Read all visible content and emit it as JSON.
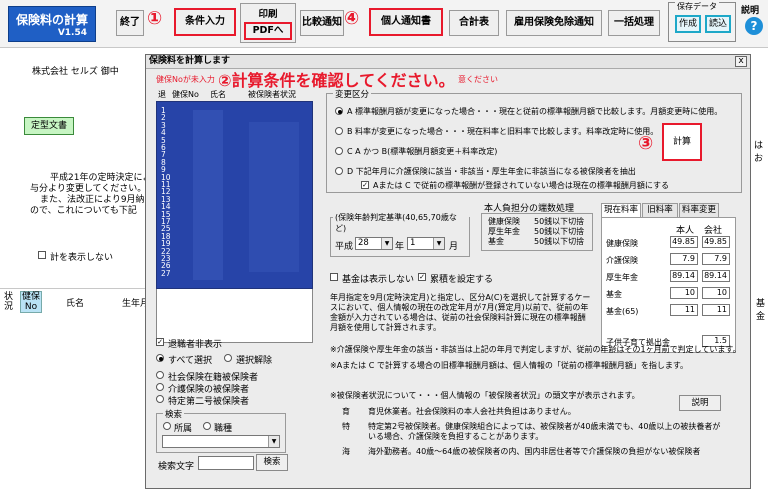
{
  "toolbar": {
    "app_title": "保険料の計算",
    "version": "V1.54",
    "end_label": "終了",
    "badge1": "①",
    "conditions_label": "条件入力",
    "print_label": "印刷",
    "pdf_label": "PDFへ",
    "compare_label": "比較通知",
    "badge4": "④",
    "personal_notice_label": "個人通知書",
    "summary_label": "合計表",
    "exemption_label": "雇用保険免除通知",
    "batch_label": "一括処理",
    "save_data_label": "保存データ",
    "create_label": "作成",
    "load_label": "読込",
    "help_label": "説明"
  },
  "sheet": {
    "company": "株式会社 セルズ 御中",
    "fixed_doc_label": "定型文書",
    "line1": "平成21年の定時決定によ",
    "line2": "与分より変更してください。",
    "line3": "また、法改正により9月納入",
    "line4": "ので、これについても下記",
    "calc_hide_label": "計を表示しない",
    "col_status": "状況",
    "col_health": "健保No",
    "col_name": "氏名",
    "col_birth": "生年月",
    "col_right": "基金",
    "right_text": "はお"
  },
  "dialog": {
    "title": "保険料を計算します",
    "close": "x",
    "notice_prefix": "健保Noが未入力",
    "headline": "②計算条件を確認してください。",
    "notice_suffix": "意ください",
    "list_headers": [
      "退",
      "健保No",
      "氏名",
      "被保険者状況"
    ],
    "employee_numbers": [
      "1",
      "2",
      "3",
      "4",
      "5",
      "6",
      "7",
      "8",
      "9",
      "10",
      "11",
      "12",
      "13",
      "14",
      "15",
      "17",
      "25",
      "18",
      "19",
      "22",
      "23",
      "26",
      "27"
    ],
    "change_group_label": "変更区分",
    "options": [
      "A 標準報酬月額が変更になった場合・・・現在と従前の標準報酬月額で比較します。月額変更時に使用。",
      "B 料率が変更になった場合・・・現在料率と旧料率で比較します。料率改定時に使用。",
      "C A かつ B(標準報酬月額変更＋料率改定)",
      "D 下記年月に介護保険に該当・非該当・厚生年金に非該当になる被保険者を抽出"
    ],
    "option_checkbox": "Aまたは C で従前の標準報酬が登録されていない場合は現在の標準報酬月額にする",
    "badge3": "③",
    "calc_button": "計算",
    "ref_month_label": "(保険年齢判定基準(40,65,70歳など)",
    "era": "平成",
    "year": "28",
    "year_suffix": "年",
    "month": "1",
    "month_suffix": "月",
    "burden_label": "本人負担分の端数処理",
    "burden_rows": [
      {
        "name": "健康保険",
        "rule": "50銭以下切捨"
      },
      {
        "name": "厚生年金",
        "rule": "50銭以下切捨"
      },
      {
        "name": "基金",
        "rule": "50銭以下切捨"
      }
    ],
    "rate_tabs": [
      "現在料率",
      "旧料率",
      "料率変更"
    ],
    "rate_head_self": "本人",
    "rate_head_company": "会社",
    "rates": [
      {
        "name": "健康保険",
        "self": "49.85",
        "company": "49.85"
      },
      {
        "name": "介護保険",
        "self": "7.9",
        "company": "7.9"
      },
      {
        "name": "厚生年金",
        "self": "89.14",
        "company": "89.14"
      },
      {
        "name": "基金",
        "self": "10",
        "company": "10"
      },
      {
        "name": "基金(65)",
        "self": "11",
        "company": "11"
      }
    ],
    "child_label": "子供子育て拠出金",
    "child_value": "1.5",
    "fund_hide": "基金は表示しない",
    "accumulate": "累積を設定する",
    "note1": "年月指定を9月(定時決定月)と指定し、区分A(C)を選択して計算するケースにおいて、個人情報の現在の改定年月が7月(算定月)以前で、従前の年金額が入力されている場合は、従前の社会保険料計算に現在の標準報酬月額を使用して計算されます。",
    "note2": "※介護保険や厚生年金の該当・非該当は上記の年月で判定しますが、従前の年齢はその1ヶ月前で判定しています。",
    "note3": "※Aまたは C で計算する場合の旧標準報酬月額は、個人情報の「従前の標準報酬月額」を指します。",
    "note4": "※被保険者状況について・・・個人情報の「被保険者状況」の頭文字が表示されます。",
    "help_button": "説明",
    "legend": [
      {
        "key": "育",
        "text": "育児休業者。社会保険料の本人会社共負担はありません。"
      },
      {
        "key": "特",
        "text": "特定第2号被保険者。健康保険組合によっては、被保険者が40歳未満でも、40歳以上の被扶養者がいる場合、介護保険を負担することがあります。"
      },
      {
        "key": "海",
        "text": "海外勤務者。40歳〜64歳の被保険者の内、国内非居住者等で介護保険の負担がない被保険者"
      }
    ],
    "retired_hidden": "退職者非表示",
    "select_all": "すべて選択",
    "deselect": "選択解除",
    "cat1": "社会保険在籍被保険者",
    "cat2": "介護保険の被保険者",
    "cat3": "特定第二号被保険者",
    "search_group": "検索",
    "search_opt1": "所属",
    "search_opt2": "職種",
    "search_text_label": "検索文字",
    "search_button": "検索"
  }
}
